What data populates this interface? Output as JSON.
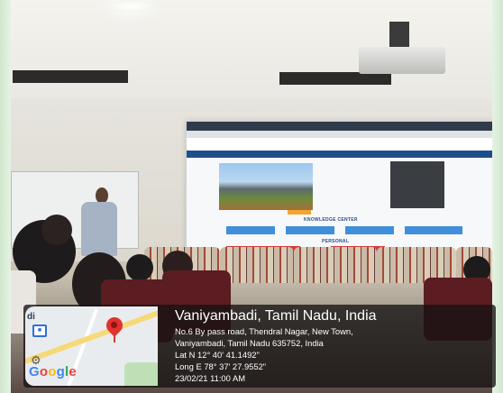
{
  "geotag": {
    "city": "Vaniyambadi, Tamil Nadu, India",
    "address_line1": "No.6 By pass road, Thendral Nagar, New Town,",
    "address_line2": "Vaniyambadi, Tamil Nadu 635752, India",
    "latitude": "Lat N 12° 40' 41.1492\"",
    "longitude": "Long E 78° 37' 27.9552\"",
    "datetime": "23/02/21 11:00 AM"
  },
  "map": {
    "corner_label": "di",
    "brand": "Google"
  },
  "projected_page": {
    "section_title": "KNOWLEDGE CENTER",
    "subsection_title": "PERSONAL"
  }
}
